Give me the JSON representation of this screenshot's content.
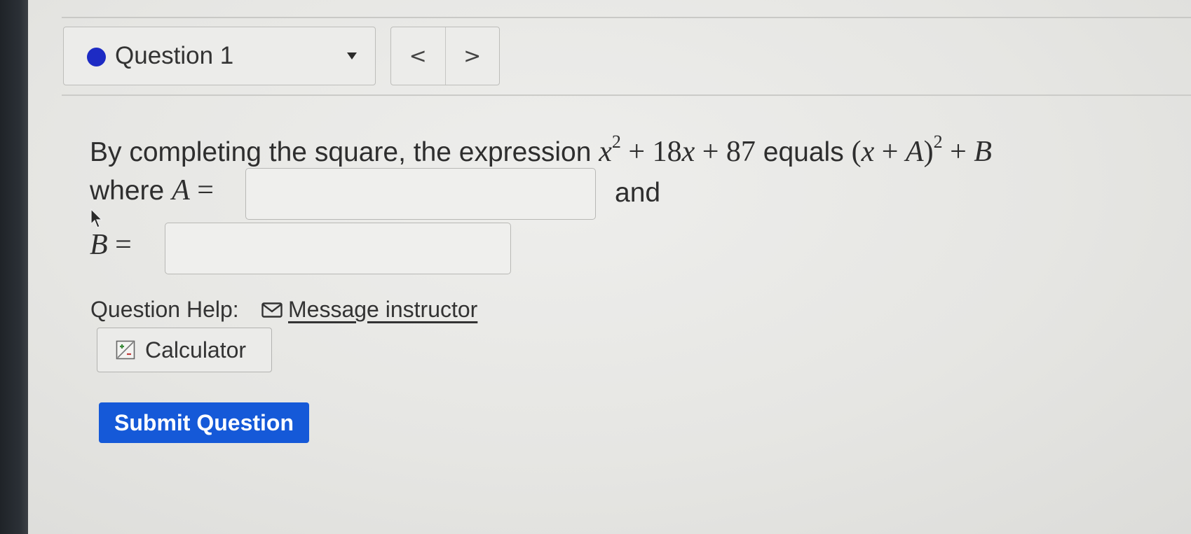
{
  "question_nav": {
    "label": "Question 1",
    "status_color": "#1d2bc4",
    "prev_glyph": "<",
    "next_glyph": ">"
  },
  "prompt": {
    "text": "By completing the square, the expression",
    "expression_var": "x",
    "expression_exp": "2",
    "expression_rest": " + 18",
    "expression_var2": "x",
    "expression_tail": " + 87",
    "equals_word": "equals",
    "form_open": "(",
    "form_var": "x",
    "form_plus": " + ",
    "form_a": "A",
    "form_close": ")",
    "form_exp": "2",
    "form_plus_b": " + ",
    "form_b": "B"
  },
  "answers": {
    "where_word": "where",
    "a_var": "A",
    "eq_sign": " =",
    "and_word": "and",
    "b_var": "B",
    "a_value": "",
    "b_value": ""
  },
  "help": {
    "label": "Question Help:",
    "message_link": "Message instructor",
    "calculator_label": "Calculator"
  },
  "actions": {
    "submit_label": "Submit Question",
    "submit_color": "#1559d8"
  }
}
